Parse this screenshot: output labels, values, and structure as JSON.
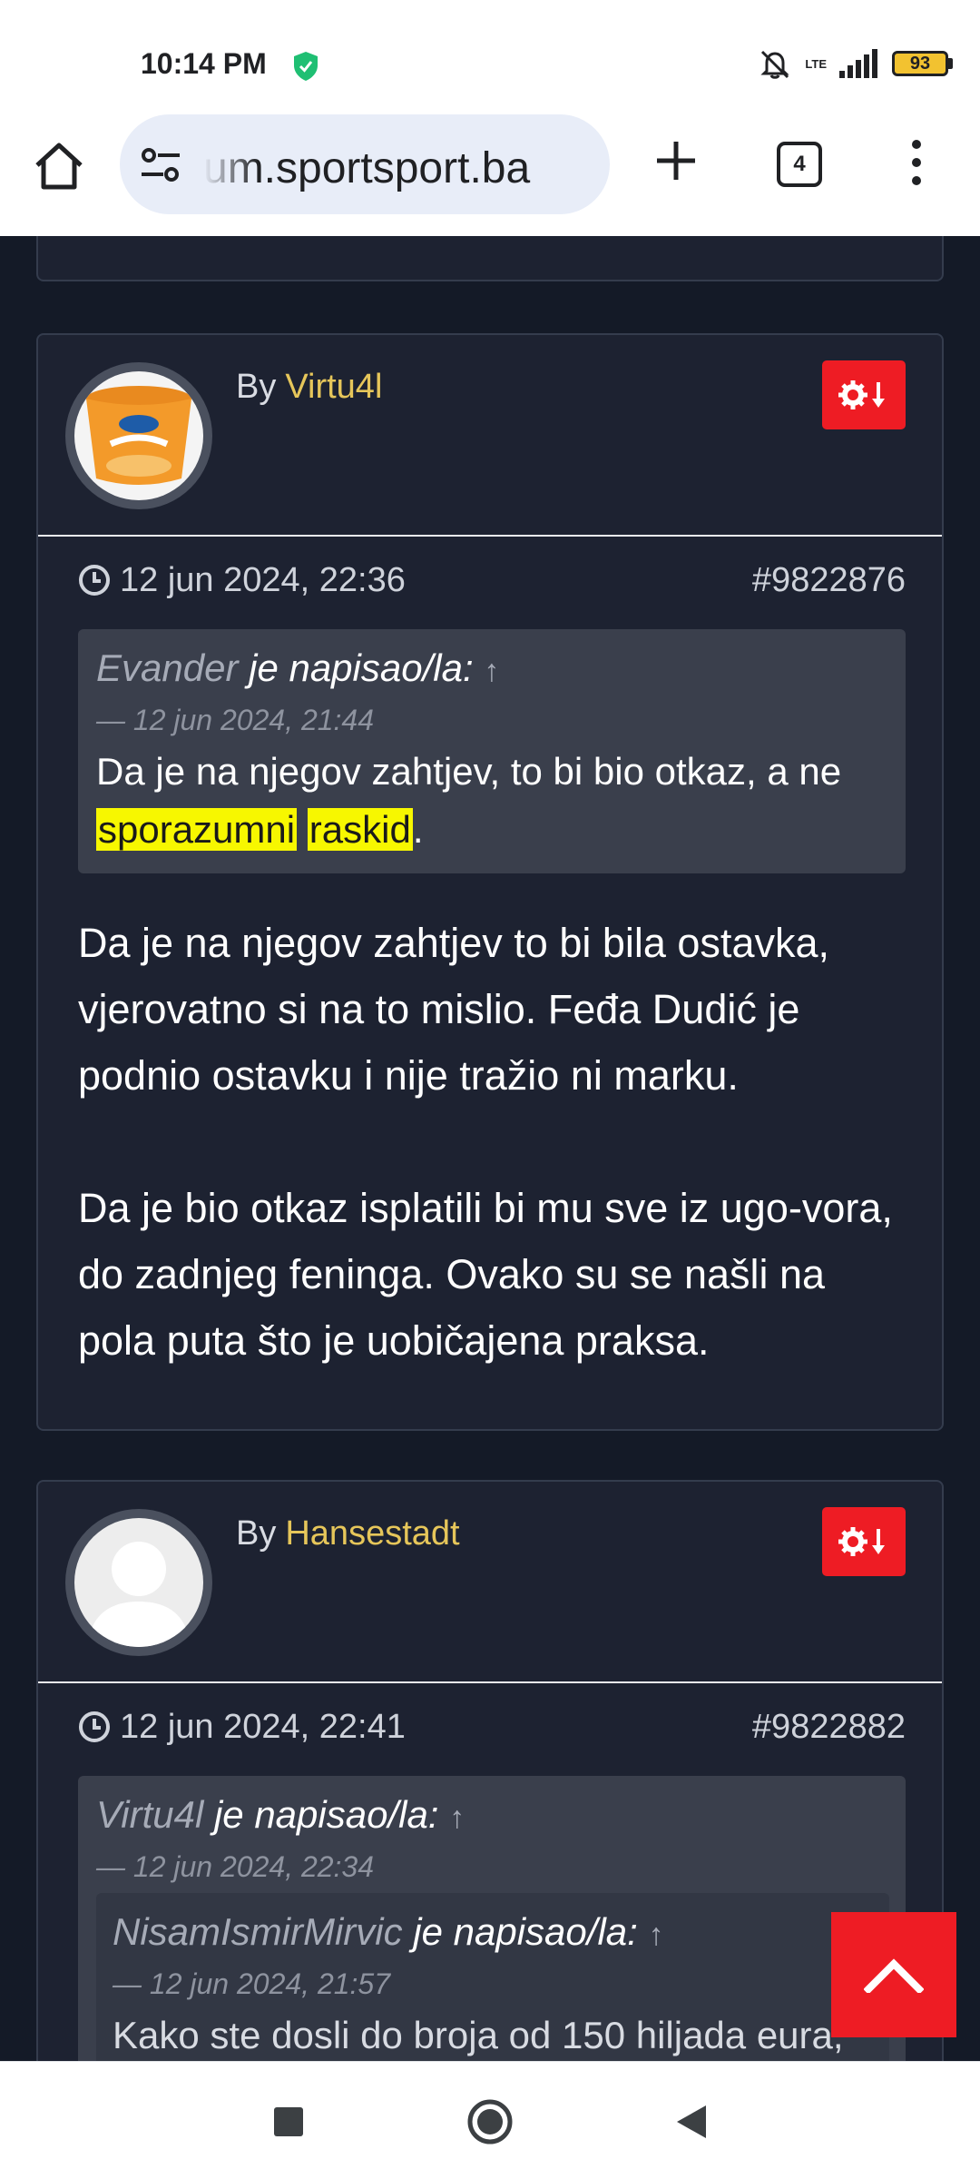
{
  "status_bar": {
    "time": "10:14 PM",
    "network": "LTE",
    "battery": "93"
  },
  "browser": {
    "url": "um.sportsport.ba",
    "tab_count": "4"
  },
  "posts": [
    {
      "prefix": "By",
      "author": "Virtu4l",
      "date": "12 jun 2024, 22:36",
      "post_id": "#9822876",
      "quote": {
        "user": "Evander",
        "wrote": "je napisao/la:",
        "arrow": "↑",
        "date": "— 12 jun 2024, 21:44",
        "text_before": "Da je na njegov zahtjev, to bi bio otkaz, a ne",
        "highlight_1": "sporazumni",
        "highlight_2": "raskid",
        "text_after": "."
      },
      "paragraphs": [
        "Da je na njegov zahtjev to bi bila ostavka, vjerovatno si na to mislio. Feđa Dudić je podnio ostavku i nije tražio ni marku.",
        "Da je bio otkaz isplatili bi mu sve iz ugo-vora, do zadnjeg feninga. Ovako su se našli na pola puta što je uobičajena praksa."
      ]
    },
    {
      "prefix": "By",
      "author": "Hansestadt",
      "date": "12 jun 2024, 22:41",
      "post_id": "#9822882",
      "quote": {
        "user": "Virtu4l",
        "wrote": "je napisao/la:",
        "arrow": "↑",
        "date": "— 12 jun 2024, 22:34",
        "nested": {
          "user": "NisamIsmirMirvic",
          "wrote": "je napisao/la:",
          "arrow": "↑",
          "date": "— 12 jun 2024, 21:57",
          "text": "Kako ste dosli do broja od 150 hiljada eura,"
        }
      }
    }
  ],
  "icons": {
    "post_options": "gear-arrow-icon",
    "scroll_top": "chevron-up-icon",
    "nav": [
      "recents-square-icon",
      "home-circle-icon",
      "back-triangle-icon"
    ]
  },
  "colors": {
    "page_bg": "#141a27",
    "card_bg": "#1d2231",
    "accent_red": "#ee1c24",
    "author_gold": "#e6c65a",
    "highlight_yellow": "#f7f700"
  }
}
